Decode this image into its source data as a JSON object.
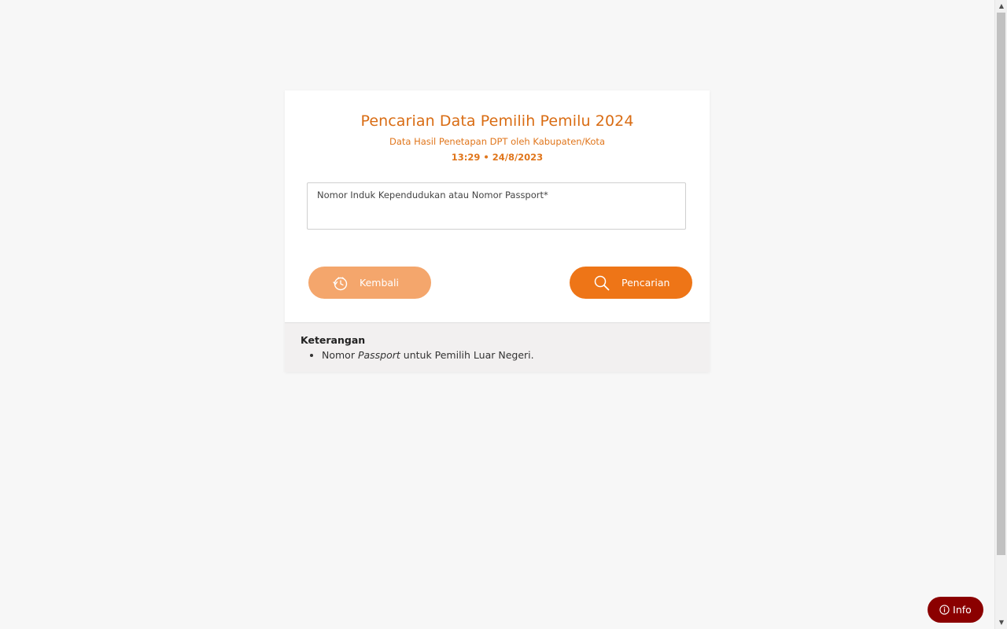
{
  "header": {
    "title": "Pencarian Data Pemilih Pemilu 2024",
    "subtitle": "Data Hasil Penetapan DPT oleh Kabupaten/Kota",
    "timestamp": "13:29 • 24/8/2023"
  },
  "form": {
    "nik_label": "Nomor Induk Kependudukan atau Nomor Passport*",
    "nik_value": ""
  },
  "buttons": {
    "back_label": "Kembali",
    "search_label": "Pencarian",
    "info_label": "Info"
  },
  "notes": {
    "title": "Keterangan",
    "items": [
      {
        "prefix": "Nomor ",
        "emphasis": "Passport",
        "suffix": " untuk Pemilih Luar Negeri."
      }
    ]
  },
  "colors": {
    "accent": "#ee7517",
    "accent_light": "#f4a66c",
    "title": "#d96c13",
    "info_button": "#8b0000"
  },
  "icons": {
    "back": "history-icon",
    "search": "search-icon",
    "info": "info-icon"
  }
}
